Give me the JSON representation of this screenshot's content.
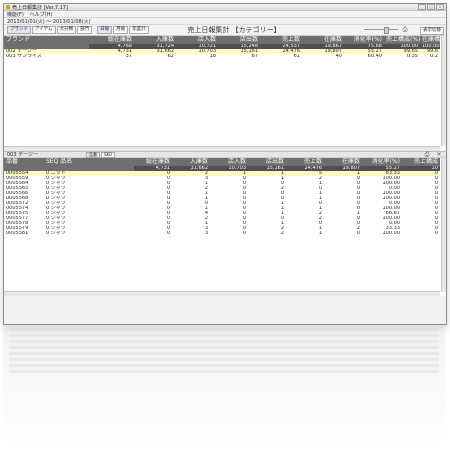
{
  "window": {
    "title": "売上日報集計 [Ver.7.17]"
  },
  "menu": [
    "機能(F)",
    "ヘルプ(H)"
  ],
  "toolbar": {
    "date_range": "2013/01/01(火) ～ 2013/01/08(火)"
  },
  "header": {
    "tabs": [
      "ブランド",
      "アイテム",
      "大分類",
      "部門"
    ],
    "period_tabs": [
      "日報",
      "月報",
      "年度計"
    ],
    "report_title": "売上日報集計 【カテゴリー】",
    "right_button": "表示切替"
  },
  "top_grid": {
    "columns": [
      "ブランド",
      "総在庫数",
      "入庫数",
      "店入数",
      "店出数",
      "売上数",
      "在庫数",
      "消化率(%)",
      "売上構成(%)",
      "在庫構成(%)"
    ],
    "totals": [
      "",
      "4,768",
      "31,724",
      "10,721",
      "15,248",
      "24,537",
      "19,867",
      "75.68",
      "100.00",
      "100.00"
    ],
    "rows": [
      [
        "002 デージー",
        "4,731",
        "31,662",
        "10,703",
        "15,161",
        "24,476",
        "19,807",
        "55.27",
        "99.65",
        "99.6"
      ],
      [
        "003 サンライズ",
        "37",
        "62",
        "18",
        "87",
        "61",
        "40",
        "60.40",
        "0.35",
        "0.2"
      ]
    ]
  },
  "bottom_panel": {
    "label": "003 デージー",
    "tabs": [
      "品番",
      "SKU"
    ]
  },
  "bottom_grid": {
    "columns": [
      "品番",
      "SEQ 品名",
      "",
      "総在庫数",
      "入庫数",
      "店入数",
      "店出数",
      "売上数",
      "在庫数",
      "消化率(%)",
      "売上構成"
    ],
    "totals": [
      "",
      "",
      "",
      "4,731",
      "31,662",
      "10,703",
      "15,161",
      "24,476",
      "19,807",
      "55.27",
      "10"
    ],
    "rows": [
      [
        "0005554",
        "0 ニット",
        "",
        "0",
        "2",
        "1",
        "1",
        "5",
        "1",
        "83.33",
        "0"
      ],
      [
        "0005559",
        "0 シャツ",
        "",
        "0",
        "3",
        "0",
        "1",
        "2",
        "0",
        "100.00",
        "0"
      ],
      [
        "0005564",
        "0 シャツ",
        "",
        "0",
        "1",
        "0",
        "0",
        "1",
        "0",
        "100.00",
        "0"
      ],
      [
        "0005565",
        "0 シャツ",
        "",
        "0",
        "2",
        "0",
        "2",
        "0",
        "0",
        "0.00",
        "0"
      ],
      [
        "0005566",
        "0 シャツ",
        "",
        "0",
        "1",
        "0",
        "0",
        "1",
        "0",
        "100.00",
        "0"
      ],
      [
        "0005568",
        "0 シャツ",
        "",
        "0",
        "1",
        "0",
        "0",
        "1",
        "0",
        "100.00",
        "0"
      ],
      [
        "0005572",
        "0 シャツ",
        "",
        "0",
        "0",
        "0",
        "1",
        "0",
        "0",
        "0.00",
        "0"
      ],
      [
        "0005574",
        "0 シャツ",
        "",
        "0",
        "1",
        "0",
        "1",
        "1",
        "0",
        "100.00",
        "0"
      ],
      [
        "0005575",
        "0 シャツ",
        "",
        "0",
        "4",
        "0",
        "1",
        "2",
        "1",
        "66.67",
        "0"
      ],
      [
        "0005577",
        "0 シャツ",
        "",
        "0",
        "2",
        "0",
        "0",
        "2",
        "0",
        "100.00",
        "0"
      ],
      [
        "0005578",
        "0 シャツ",
        "",
        "0",
        "1",
        "0",
        "1",
        "0",
        "0",
        "0.00",
        "0"
      ],
      [
        "0005579",
        "0 シャツ",
        "",
        "0",
        "3",
        "0",
        "2",
        "1",
        "2",
        "33.33",
        "0"
      ],
      [
        "0005581",
        "0 シャツ",
        "",
        "0",
        "3",
        "0",
        "2",
        "1",
        "0",
        "100.00",
        "0"
      ]
    ]
  },
  "colors": {
    "header_bg": "#6e6e6e",
    "total_bg": "#4f4f4f",
    "highlight_row": "#fff9c4"
  }
}
